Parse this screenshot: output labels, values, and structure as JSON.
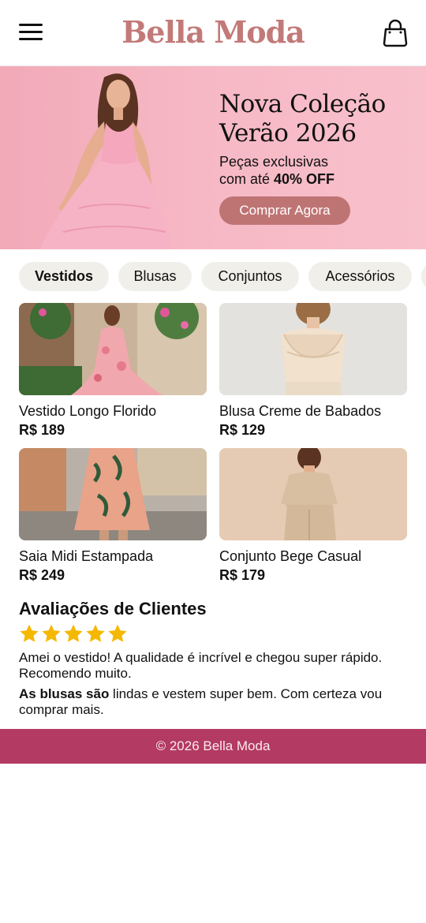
{
  "colors": {
    "brand": "#c27a78",
    "cta": "#bf7474",
    "footer": "#b33a62",
    "star": "#f5b800"
  },
  "header": {
    "brand_name": "Bella Moda",
    "menu_icon": "hamburger-menu-icon",
    "cart_icon": "shopping-bag-icon"
  },
  "hero": {
    "title_line1": "Nova Coleção",
    "title_line2": "Verão 2026",
    "subtitle_line1": "Peças exclusivas",
    "subtitle_prefix": "com até ",
    "subtitle_highlight": "40% OFF",
    "cta_label": "Comprar Agora"
  },
  "categories": [
    {
      "label": "Vestidos",
      "active": true
    },
    {
      "label": "Blusas",
      "active": false
    },
    {
      "label": "Conjuntos",
      "active": false
    },
    {
      "label": "Acessórios",
      "active": false
    }
  ],
  "products": [
    {
      "name": "Vestido Longo Florido",
      "price": "R$ 189"
    },
    {
      "name": "Blusa Creme de Babados",
      "price": "R$ 129"
    },
    {
      "name": "Saia Midi Estampada",
      "price": "R$ 249"
    },
    {
      "name": "Conjunto Bege Casual",
      "price": "R$ 179"
    }
  ],
  "reviews": {
    "title": "Avaliações de Clientes",
    "rating": 5,
    "review1": "Amei o vestido! A qualidade é incrível e chegou super rápido. Recomendo muito.",
    "review2_bold": "As blusas são",
    "review2_rest": " lindas e vestem super bem. Com certeza vou comprar mais."
  },
  "footer": {
    "text": "© 2026 Bella Moda"
  }
}
